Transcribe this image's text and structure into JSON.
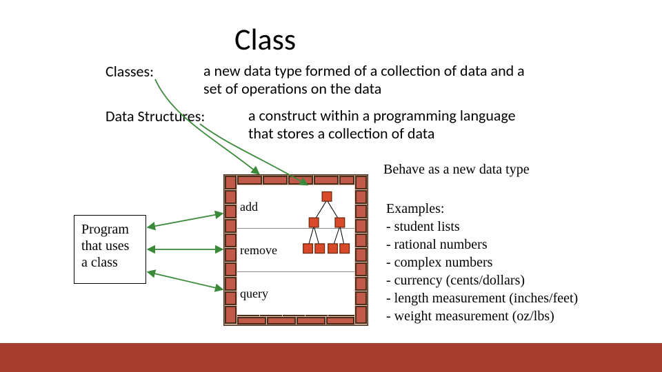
{
  "title": "Class",
  "defs": {
    "classes_label": "Classes:",
    "classes_text": "a new data type formed of a collection of data and a set of operations on the data",
    "ds_label": "Data Structures:",
    "ds_text": "a construct within a programming language that stores a collection of data"
  },
  "behave_text": "Behave as a new data type",
  "program_box": "Program that uses a class",
  "operations": {
    "add": "add",
    "remove": "remove",
    "query": "query"
  },
  "examples": {
    "heading": "Examples:",
    "items": [
      "- student lists",
      "- rational numbers",
      "- complex numbers",
      "- currency (cents/dollars)",
      "- length measurement (inches/feet)",
      "- weight measurement (oz/lbs)"
    ]
  },
  "colors": {
    "brick_fill": "#c15a4a",
    "brick_mortar": "#e8c8bb",
    "brick_border": "#4a2e1a",
    "node_fill": "#d84a2a",
    "node_border": "#6a2a10",
    "arrow_green": "#3a8a3a",
    "bottom_bar": "#a53c2e"
  }
}
